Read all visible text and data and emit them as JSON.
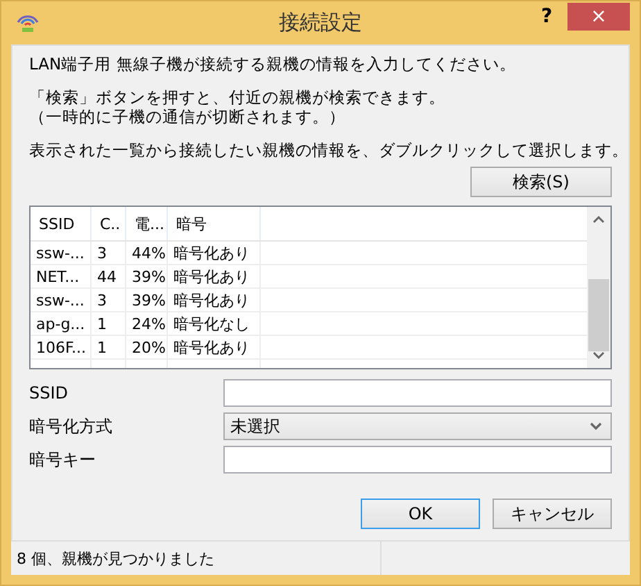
{
  "window": {
    "title": "接続設定",
    "help": "?",
    "close": "×"
  },
  "intro": [
    "LAN端子用 無線子機が接続する親機の情報を入力してください。",
    "「検索」ボタンを押すと、付近の親機が検索できます。",
    "（一時的に子機の通信が切断されます。）",
    "表示された一覧から接続したい親機の情報を、ダブルクリックして選択します。"
  ],
  "search_button": "検索(S)",
  "table": {
    "columns": [
      "SSID",
      "C..",
      "電...",
      "暗号"
    ],
    "rows": [
      [
        "ssw-...",
        "3",
        "44%",
        "暗号化あり"
      ],
      [
        "NET...",
        "44",
        "39%",
        "暗号化あり"
      ],
      [
        "ssw-...",
        "3",
        "39%",
        "暗号化あり"
      ],
      [
        "ap-g...",
        "1",
        "24%",
        "暗号化なし"
      ],
      [
        "106F...",
        "1",
        "20%",
        "暗号化あり"
      ]
    ]
  },
  "form": [
    {
      "kind": "text",
      "label": "SSID"
    },
    {
      "kind": "select",
      "label": "暗号化方式",
      "value": "未選択"
    },
    {
      "kind": "text",
      "label": "暗号キー"
    }
  ],
  "buttons": [
    {
      "label": "OK",
      "default": true
    },
    {
      "label": "キャンセル",
      "default": false
    }
  ],
  "status_bar": "8 個、親機が見つかりました"
}
